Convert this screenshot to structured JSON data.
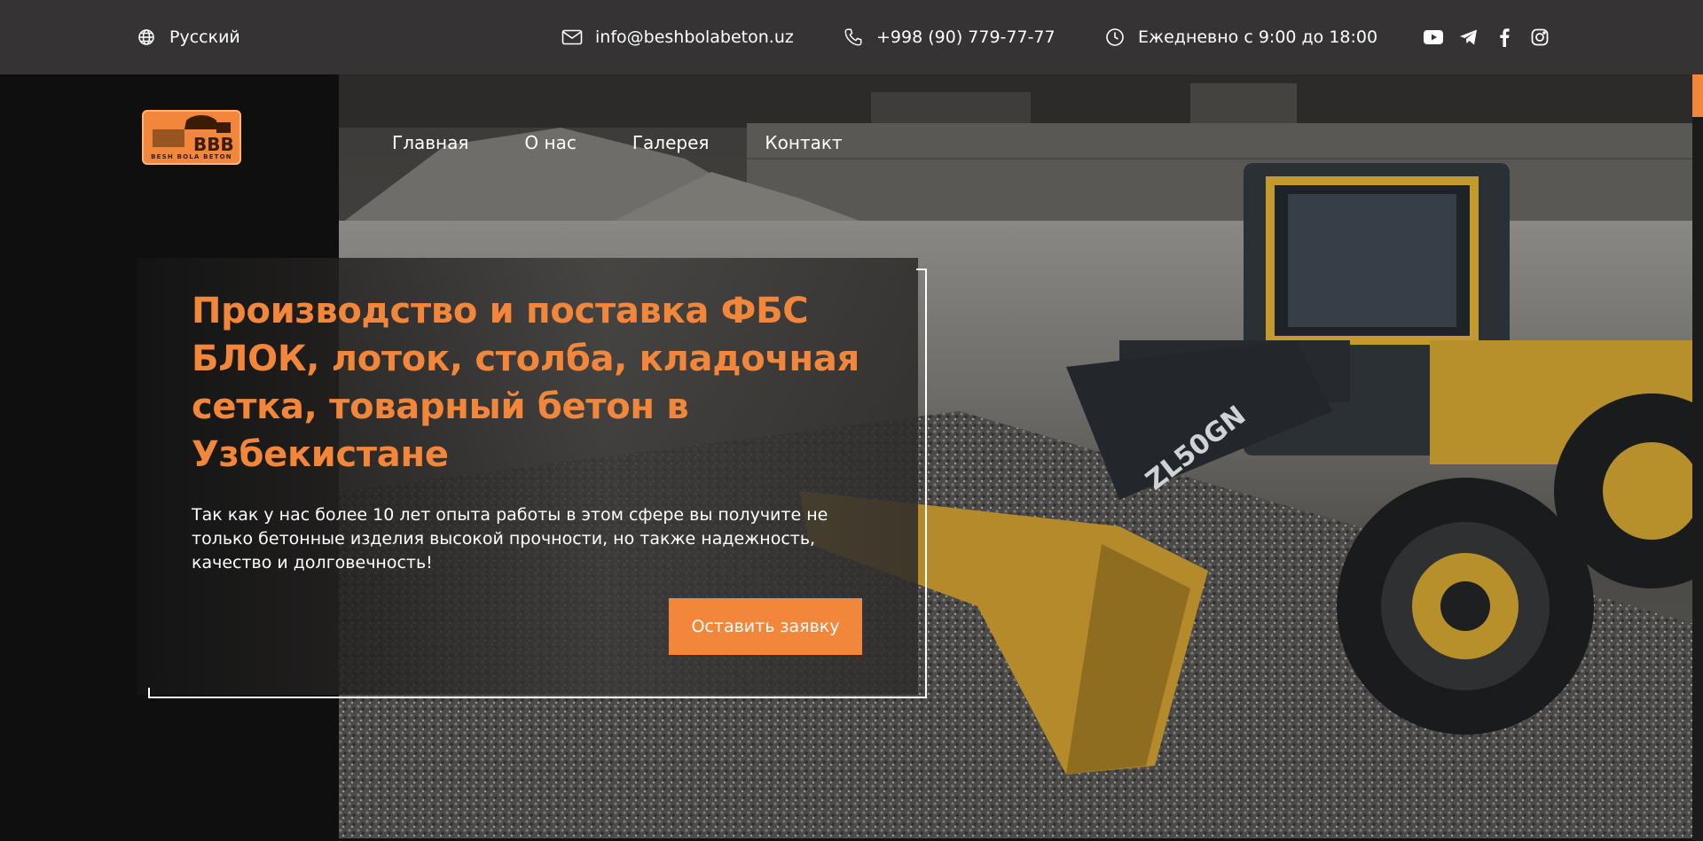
{
  "topbar": {
    "language": "Русский",
    "email": "info@beshbolabeton.uz",
    "phone": "+998 (90) 779-77-77",
    "hours": "Ежедневно с 9:00 до 18:00"
  },
  "social": [
    "youtube-icon",
    "telegram-icon",
    "facebook-icon",
    "instagram-icon"
  ],
  "logo": {
    "text": "BESH BOLA BETON",
    "mark": "BBB"
  },
  "nav": {
    "items": [
      {
        "label": "Главная"
      },
      {
        "label": "О нас"
      },
      {
        "label": "Галерея"
      },
      {
        "label": "Контакт"
      }
    ]
  },
  "hero": {
    "title": "Производство и поставка ФБС БЛОК, лоток, столба, кладочная сетка, товарный бетон в Узбекистане",
    "description": "Так как у нас более 10 лет опыта работы в этом сфере вы получите не только бетонные изделия высокой прочности, но также надежность, качество и долговечность!",
    "cta_label": "Оставить заявку",
    "photo_label": "ZL50GN"
  },
  "colors": {
    "accent": "#f2873b",
    "topbar": "#353333",
    "background": "#0f0f0f"
  }
}
